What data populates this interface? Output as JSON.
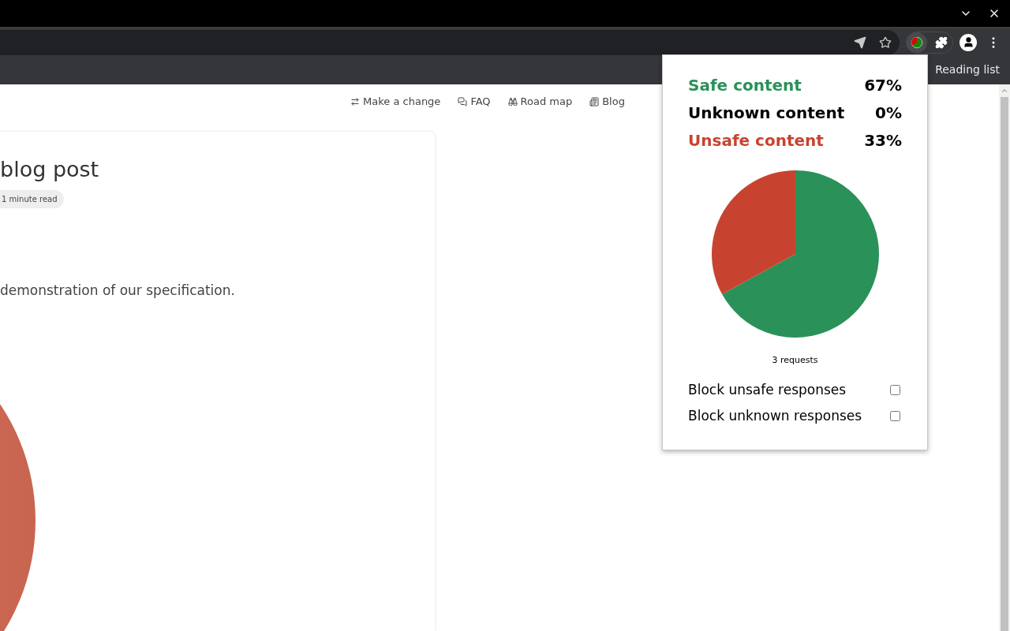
{
  "bookmarks_bar": {
    "reading_list": "Reading list"
  },
  "nav": [
    {
      "label": "Make a change"
    },
    {
      "label": "FAQ"
    },
    {
      "label": "Road map"
    },
    {
      "label": "Blog"
    }
  ],
  "post": {
    "title": "blog post",
    "badge": "1 minute read",
    "text": "demonstration of our specification."
  },
  "popup": {
    "stats": [
      {
        "label": "Safe content",
        "value": "67%",
        "color": "#2a9158"
      },
      {
        "label": "Unknown content",
        "value": "0%",
        "color": "#000000"
      },
      {
        "label": "Unsafe content",
        "value": "33%",
        "color": "#c8432f"
      }
    ],
    "chart_data": {
      "type": "pie",
      "values": [
        67,
        0,
        33
      ]
    },
    "caption": "3 requests",
    "options": [
      {
        "label": "Block unsafe responses",
        "checked": false
      },
      {
        "label": "Block unknown responses",
        "checked": false
      }
    ]
  }
}
